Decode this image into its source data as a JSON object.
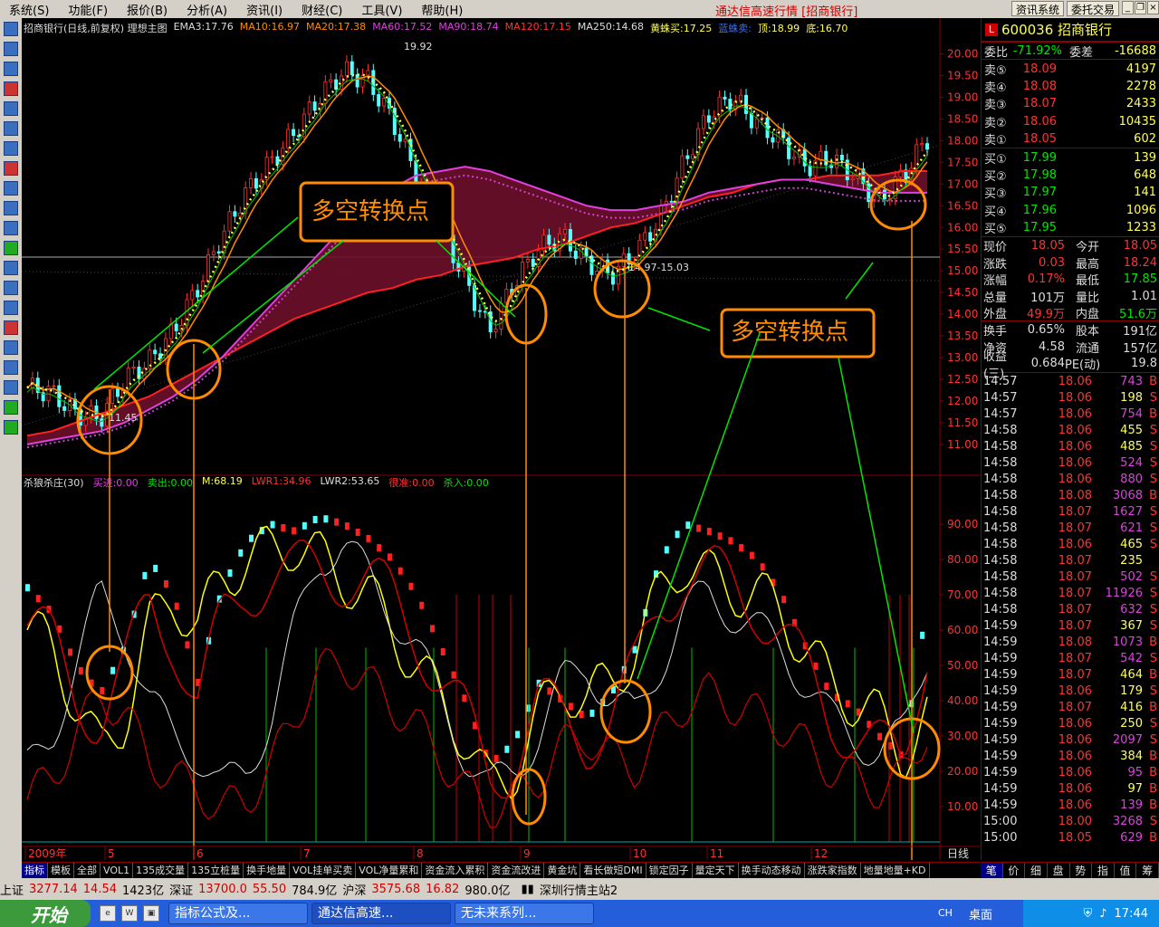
{
  "menu": [
    "系统(S)",
    "功能(F)",
    "报价(B)",
    "分析(A)",
    "资讯(I)",
    "财经(C)",
    "工具(V)",
    "帮助(H)"
  ],
  "app_title": "通达信高速行情 [招商银行]",
  "top_buttons": [
    "资讯系统",
    "委托交易"
  ],
  "chart_header": {
    "title": "招商银行(日线,前复权) 理想主图",
    "ema3": "EMA3:17.76",
    "ma10": "MA10:16.97",
    "ma20": "MA20:17.38",
    "ma60": "MA60:17.52",
    "ma90": "MA90:18.74",
    "ma120": "MA120:17.15",
    "ma250": "MA250:14.68",
    "jz_buy": "黄蛛买:17.25",
    "lan_sell": "蓝蛛卖:",
    "top": "顶:18.99",
    "bottom": "底:16.70"
  },
  "indicator_header": {
    "name": "杀狼杀庄(30)",
    "buy": "买进:0.00",
    "sell": "卖出:0.00",
    "m": "M:68.19",
    "lwr1": "LWR1:34.96",
    "lwr2": "LWR2:53.65",
    "hen": "很准:0.00",
    "kill": "杀入:0.00"
  },
  "annotations": {
    "duokong_1": "多空转换点",
    "duokong_2": "多空转换点",
    "high_label": "19.92",
    "low_label": "11.45",
    "range_label": "14.97-15.03"
  },
  "price_axis": [
    "20.00",
    "19.50",
    "19.00",
    "18.50",
    "18.00",
    "17.50",
    "17.00",
    "16.50",
    "16.00",
    "15.50",
    "15.00",
    "14.50",
    "14.00",
    "13.50",
    "13.00",
    "12.50",
    "12.00",
    "11.50",
    "11.00"
  ],
  "ind_axis": [
    "90.00",
    "80.00",
    "70.00",
    "60.00",
    "50.00",
    "40.00",
    "30.00",
    "20.00",
    "10.00"
  ],
  "months": [
    "2009年",
    "5",
    "6",
    "7",
    "8",
    "9",
    "10",
    "11",
    "12"
  ],
  "period_label": "日线",
  "stock": {
    "code": "600036",
    "name": "招商银行",
    "weibi_label": "委比",
    "weibi": "-71.92%",
    "weicha_label": "委差",
    "weicha": "-16688"
  },
  "sell_orders": [
    {
      "label": "卖⑤",
      "price": "18.09",
      "vol": "4197"
    },
    {
      "label": "卖④",
      "price": "18.08",
      "vol": "2278"
    },
    {
      "label": "卖③",
      "price": "18.07",
      "vol": "2433"
    },
    {
      "label": "卖②",
      "price": "18.06",
      "vol": "10435"
    },
    {
      "label": "卖①",
      "price": "18.05",
      "vol": "602"
    }
  ],
  "buy_orders": [
    {
      "label": "买①",
      "price": "17.99",
      "vol": "139"
    },
    {
      "label": "买②",
      "price": "17.98",
      "vol": "648"
    },
    {
      "label": "买③",
      "price": "17.97",
      "vol": "141"
    },
    {
      "label": "买④",
      "price": "17.96",
      "vol": "1096"
    },
    {
      "label": "买⑤",
      "price": "17.95",
      "vol": "1233"
    }
  ],
  "quote": [
    {
      "a": "现价",
      "b": "18.05",
      "c": "今开",
      "d": "18.05",
      "bc": "red",
      "dc": "red"
    },
    {
      "a": "涨跌",
      "b": "0.03",
      "c": "最高",
      "d": "18.24",
      "bc": "red",
      "dc": "red"
    },
    {
      "a": "涨幅",
      "b": "0.17%",
      "c": "最低",
      "d": "17.85",
      "bc": "red",
      "dc": "green"
    },
    {
      "a": "总量",
      "b": "101万",
      "c": "量比",
      "d": "1.01",
      "bc": "white",
      "dc": "white"
    },
    {
      "a": "外盘",
      "b": "49.9万",
      "c": "内盘",
      "d": "51.6万",
      "bc": "red",
      "dc": "green"
    },
    {
      "a": "换手",
      "b": "0.65%",
      "c": "股本",
      "d": "191亿",
      "bc": "white",
      "dc": "white"
    },
    {
      "a": "净资",
      "b": "4.58",
      "c": "流通",
      "d": "157亿",
      "bc": "white",
      "dc": "white"
    },
    {
      "a": "收益(三)",
      "b": "0.684",
      "c": "PE(动)",
      "d": "19.8",
      "bc": "white",
      "dc": "white"
    }
  ],
  "trades": [
    {
      "t": "14:57",
      "p": "18.06",
      "v": "743",
      "bs": "B",
      "c": "mag"
    },
    {
      "t": "14:57",
      "p": "18.06",
      "v": "198",
      "bs": "S",
      "c": "yel"
    },
    {
      "t": "14:57",
      "p": "18.06",
      "v": "754",
      "bs": "B",
      "c": "mag"
    },
    {
      "t": "14:58",
      "p": "18.06",
      "v": "455",
      "bs": "S",
      "c": "yel"
    },
    {
      "t": "14:58",
      "p": "18.06",
      "v": "485",
      "bs": "S",
      "c": "yel"
    },
    {
      "t": "14:58",
      "p": "18.06",
      "v": "524",
      "bs": "S",
      "c": "mag"
    },
    {
      "t": "14:58",
      "p": "18.06",
      "v": "880",
      "bs": "S",
      "c": "mag"
    },
    {
      "t": "14:58",
      "p": "18.08",
      "v": "3068",
      "bs": "B",
      "c": "mag"
    },
    {
      "t": "14:58",
      "p": "18.07",
      "v": "1627",
      "bs": "S",
      "c": "mag"
    },
    {
      "t": "14:58",
      "p": "18.07",
      "v": "621",
      "bs": "S",
      "c": "mag"
    },
    {
      "t": "14:58",
      "p": "18.06",
      "v": "465",
      "bs": "S",
      "c": "yel"
    },
    {
      "t": "14:58",
      "p": "18.07",
      "v": "235",
      "bs": "",
      "c": "yel"
    },
    {
      "t": "14:58",
      "p": "18.07",
      "v": "502",
      "bs": "S",
      "c": "mag"
    },
    {
      "t": "14:58",
      "p": "18.07",
      "v": "11926",
      "bs": "S",
      "c": "mag"
    },
    {
      "t": "14:58",
      "p": "18.07",
      "v": "632",
      "bs": "S",
      "c": "mag"
    },
    {
      "t": "14:59",
      "p": "18.07",
      "v": "367",
      "bs": "S",
      "c": "yel"
    },
    {
      "t": "14:59",
      "p": "18.08",
      "v": "1073",
      "bs": "B",
      "c": "mag"
    },
    {
      "t": "14:59",
      "p": "18.07",
      "v": "542",
      "bs": "S",
      "c": "mag"
    },
    {
      "t": "14:59",
      "p": "18.07",
      "v": "464",
      "bs": "B",
      "c": "yel"
    },
    {
      "t": "14:59",
      "p": "18.06",
      "v": "179",
      "bs": "S",
      "c": "yel"
    },
    {
      "t": "14:59",
      "p": "18.07",
      "v": "416",
      "bs": "B",
      "c": "yel"
    },
    {
      "t": "14:59",
      "p": "18.06",
      "v": "250",
      "bs": "S",
      "c": "yel"
    },
    {
      "t": "14:59",
      "p": "18.06",
      "v": "2097",
      "bs": "S",
      "c": "mag"
    },
    {
      "t": "14:59",
      "p": "18.06",
      "v": "384",
      "bs": "B",
      "c": "yel"
    },
    {
      "t": "14:59",
      "p": "18.06",
      "v": "95",
      "bs": "B",
      "c": "mag"
    },
    {
      "t": "14:59",
      "p": "18.06",
      "v": "97",
      "bs": "B",
      "c": "yel"
    },
    {
      "t": "14:59",
      "p": "18.06",
      "v": "139",
      "bs": "B",
      "c": "mag"
    },
    {
      "t": "15:00",
      "p": "18.00",
      "v": "3268",
      "bs": "S",
      "c": "mag",
      "pc": "green"
    },
    {
      "t": "15:00",
      "p": "18.05",
      "v": "629",
      "bs": "B",
      "c": "mag"
    }
  ],
  "right_tabs": [
    "笔",
    "价",
    "细",
    "盘",
    "势",
    "指",
    "值",
    "筹"
  ],
  "indicator_tabs": [
    "指标",
    "模板",
    "全部",
    "VOL1",
    "135成交量",
    "135立桩量",
    "换手地量",
    "VOL挂单买卖",
    "VOL净量累和",
    "资金流入累积",
    "资金流改进",
    "黄金坑",
    "看长做短DMI",
    "锁定因子",
    "量定天下",
    "换手动态移动",
    "涨跌家指数",
    "地量地量+KD"
  ],
  "status": {
    "sh_label": "上证",
    "sh": "3277.14",
    "sh_chg": "14.54",
    "sh_amt": "1423亿",
    "sz_label": "深证",
    "sz": "13700.0",
    "sz_chg": "55.50",
    "sz_amt": "784.9亿",
    "hs_label": "沪深",
    "hs": "3575.68",
    "hs_chg": "16.82",
    "hs_amt": "980.0亿",
    "server": "深圳行情主站2"
  },
  "taskbar": {
    "start": "开始",
    "tasks": [
      "指标公式及...",
      "通达信高速...",
      "无未来系列..."
    ],
    "lang": "CH",
    "desktop": "桌面",
    "clock": "17:44"
  },
  "chart_data": {
    "type": "candlestick",
    "title": "招商银行(日线,前复权) 理想主图",
    "price_ylim": [
      10.6,
      20.2
    ],
    "indicator_ylim": [
      0,
      100
    ],
    "x_categories": [
      "2009-04",
      "2009-05",
      "2009-06",
      "2009-07",
      "2009-08",
      "2009-09",
      "2009-10",
      "2009-11",
      "2009-12"
    ],
    "close_approx": [
      12.3,
      12.2,
      11.7,
      11.6,
      12.5,
      12.9,
      13.6,
      14.6,
      15.8,
      16.8,
      17.5,
      18.2,
      19.0,
      19.6,
      19.4,
      18.5,
      17.2,
      16.0,
      14.8,
      13.6,
      14.7,
      15.5,
      15.8,
      15.2,
      14.9,
      15.4,
      16.2,
      17.5,
      18.6,
      19.0,
      18.4,
      18.0,
      17.4,
      17.6,
      17.2,
      16.6,
      17.2,
      18.05
    ],
    "series": [
      {
        "name": "MA250",
        "values": [
          11.2,
          11.3,
          11.5,
          11.7,
          11.9,
          12.1,
          12.4,
          12.7,
          13.0,
          13.3,
          13.6,
          13.9,
          14.1,
          14.3,
          14.5,
          14.6,
          14.8,
          14.9,
          15.1,
          15.2,
          15.3,
          15.5,
          15.6,
          15.8,
          16.0,
          16.1,
          16.3,
          16.5,
          16.7,
          16.8,
          17.0,
          17.1,
          17.1,
          17.2,
          17.2,
          17.2,
          17.3,
          17.3
        ]
      },
      {
        "name": "MA90",
        "values": [
          11.0,
          11.1,
          11.2,
          11.3,
          11.5,
          11.8,
          12.1,
          12.5,
          13.0,
          13.6,
          14.2,
          14.8,
          15.4,
          16.0,
          16.5,
          16.9,
          17.2,
          17.3,
          17.4,
          17.3,
          17.1,
          16.9,
          16.7,
          16.5,
          16.4,
          16.4,
          16.5,
          16.6,
          16.8,
          16.9,
          17.0,
          17.1,
          17.1,
          17.0,
          16.9,
          16.8,
          16.8,
          16.8
        ]
      },
      {
        "name": "M",
        "values": [
          72,
          65,
          50,
          42,
          55,
          80,
          70,
          45,
          72,
          85,
          90,
          88,
          92,
          90,
          86,
          80,
          70,
          55,
          40,
          22,
          28,
          45,
          40,
          35,
          42,
          55,
          80,
          90,
          88,
          85,
          80,
          70,
          55,
          42,
          38,
          30,
          24,
          68.19
        ]
      },
      {
        "name": "LWR1",
        "values": [
          60,
          55,
          40,
          25,
          35,
          60,
          70,
          60,
          75,
          80,
          82,
          85,
          80,
          75,
          70,
          60,
          50,
          40,
          30,
          15,
          20,
          35,
          45,
          40,
          45,
          55,
          70,
          80,
          75,
          72,
          70,
          65,
          55,
          45,
          40,
          35,
          25,
          34.96
        ]
      },
      {
        "name": "LWR2",
        "values": [
          20,
          30,
          50,
          70,
          60,
          40,
          30,
          25,
          15,
          20,
          35,
          60,
          80,
          85,
          75,
          65,
          55,
          40,
          25,
          15,
          20,
          30,
          45,
          50,
          40,
          35,
          50,
          65,
          70,
          65,
          60,
          55,
          45,
          35,
          30,
          25,
          30,
          53.65
        ]
      }
    ]
  }
}
